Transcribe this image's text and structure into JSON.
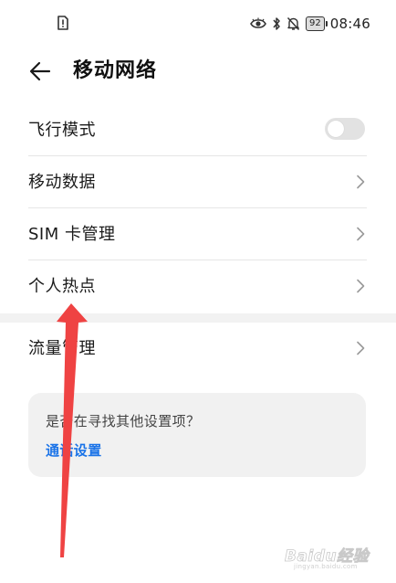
{
  "status_bar": {
    "battery_level": "92",
    "time": "08:46",
    "icons": [
      "sim-alert-icon",
      "eye-comfort-icon",
      "bluetooth-icon",
      "mute-bell-icon",
      "battery-icon"
    ]
  },
  "header": {
    "title": "移动网络",
    "back_icon": "back-arrow-icon"
  },
  "settings": {
    "items": [
      {
        "label": "飞行模式",
        "control": "toggle",
        "enabled": false
      },
      {
        "label": "移动数据",
        "control": "chevron"
      },
      {
        "label": "SIM 卡管理",
        "control": "chevron"
      },
      {
        "label": "个人热点",
        "control": "chevron"
      }
    ],
    "usage_item": {
      "label": "流量管理",
      "control": "chevron"
    }
  },
  "suggestion": {
    "question": "是否在寻找其他设置项？",
    "link": "通话设置"
  },
  "annotation": {
    "color": "#ef4343"
  },
  "watermark": {
    "text": "Baidu经验",
    "sub": "jingyan.baidu.com"
  }
}
